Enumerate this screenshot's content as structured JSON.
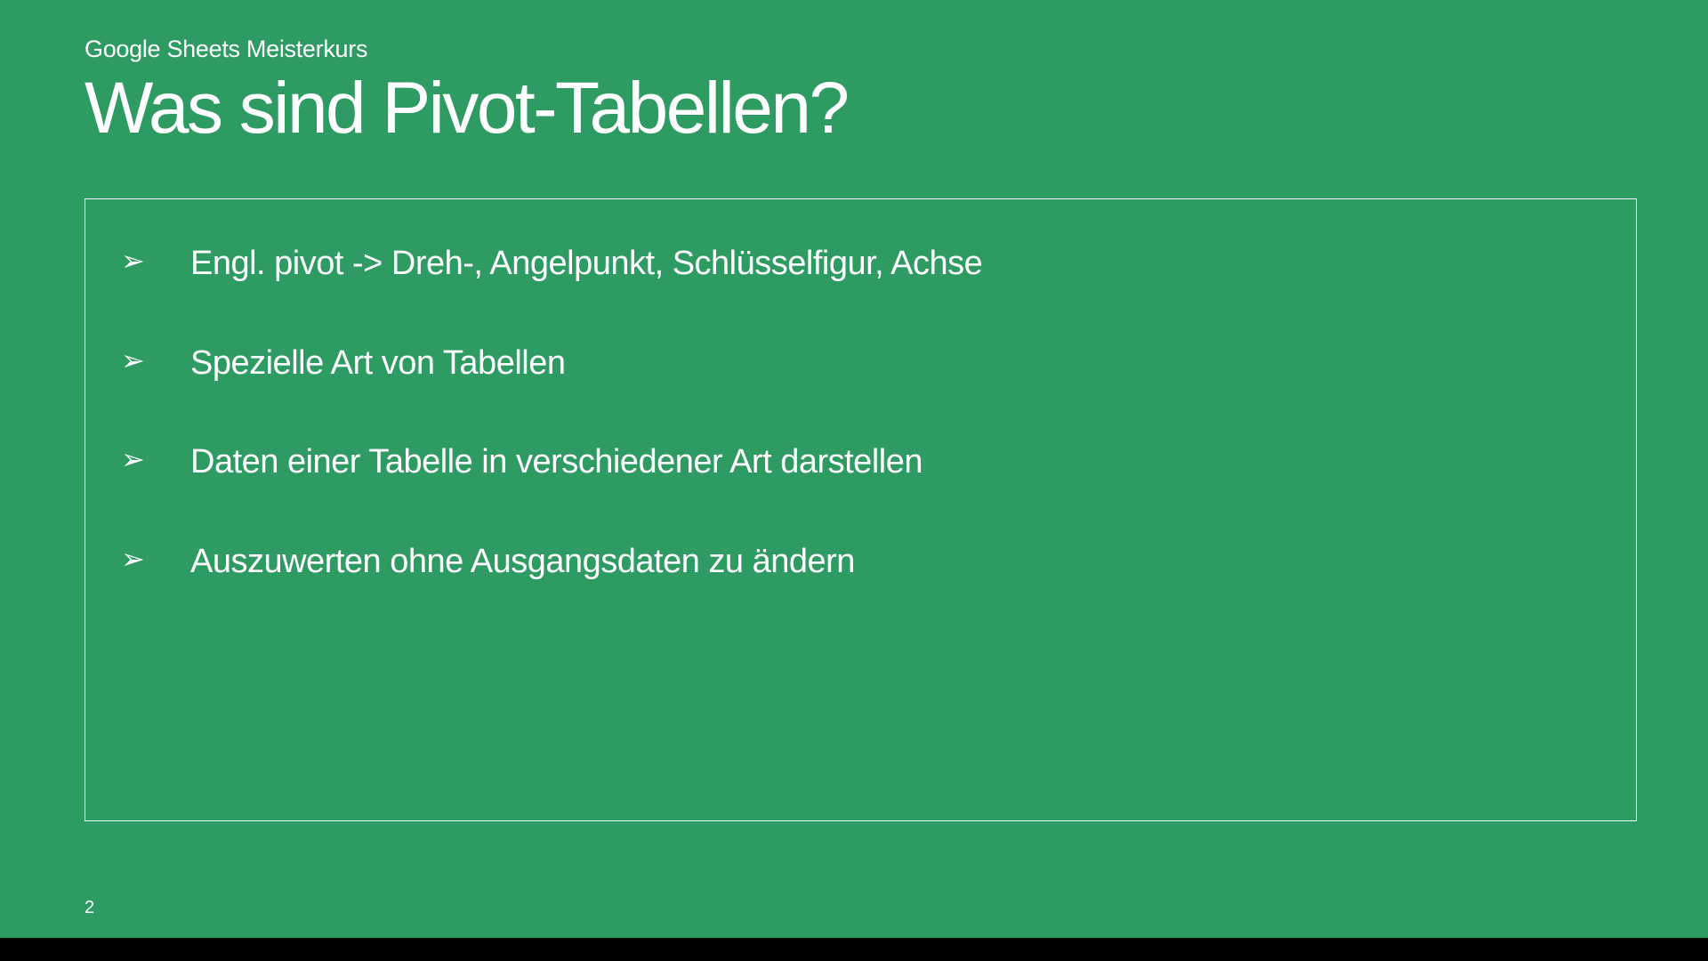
{
  "subtitle": "Google Sheets Meisterkurs",
  "title": "Was sind Pivot-Tabellen?",
  "bullets": [
    "Engl. pivot -> Dreh-, Angelpunkt, Schlüsselfigur, Achse",
    "Spezielle Art von Tabellen",
    "Daten einer Tabelle in verschiedener Art darstellen",
    "Auszuwerten ohne Ausgangsdaten zu ändern"
  ],
  "bullet_marker": "➢",
  "page_number": "2"
}
